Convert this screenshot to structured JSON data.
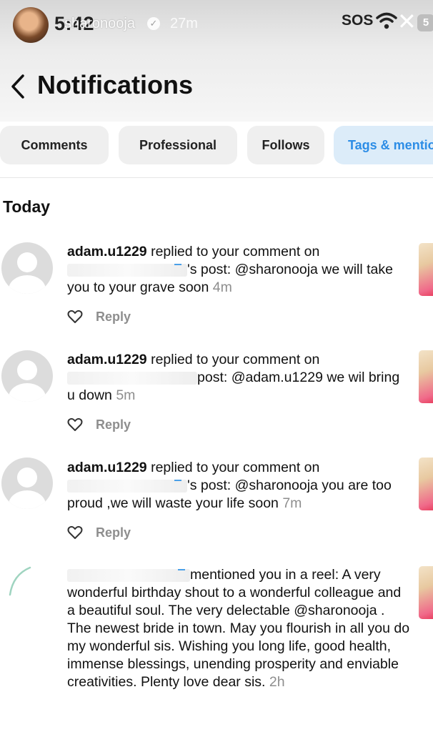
{
  "status_bar": {
    "time": "5:42",
    "story_username": "sharonooja",
    "story_age": "27m",
    "sos": "SOS",
    "battery": "5"
  },
  "header": {
    "title": "Notifications"
  },
  "tabs": [
    {
      "label": "Comments",
      "active": false
    },
    {
      "label": "Professional",
      "active": false
    },
    {
      "label": "Follows",
      "active": false
    },
    {
      "label": "Tags & mentions",
      "active": true
    }
  ],
  "section": {
    "heading": "Today"
  },
  "notifications": [
    {
      "user": "adam.u1229",
      "action": " replied to your comment on ",
      "middle": "'s post: @sharonooja we will take you to your grave soon",
      "time": "4m",
      "reply_label": "Reply"
    },
    {
      "user": "adam.u1229",
      "action": " replied to your comment on ",
      "middle": "post: @adam.u1229 we wil bring u down",
      "time": "5m",
      "reply_label": "Reply"
    },
    {
      "user": "adam.u1229",
      "action": " replied to your comment on ",
      "middle": "'s post: @sharonooja you are too proud ,we will waste your life soon",
      "time": "7m",
      "reply_label": "Reply"
    },
    {
      "action": "mentioned you in a reel: A very wonderful birthday shout to a wonderful colleague and a beautiful soul. The very delectable @sharonooja . The newest bride in town. May you flourish in all you do my wonderful sis. Wishing you long life, good health, immense blessings, unending prosperity and enviable creativities. Plenty love dear sis.",
      "time": "2h"
    }
  ],
  "icons": {
    "back": "chevron-left-icon",
    "like": "heart-outline-icon",
    "wifi": "wifi-icon",
    "close": "close-icon",
    "verified": "verified-badge-icon"
  },
  "colors": {
    "accent": "#2d8de6",
    "tab_active_bg": "#dcecf9",
    "muted": "#8e8e8e"
  }
}
